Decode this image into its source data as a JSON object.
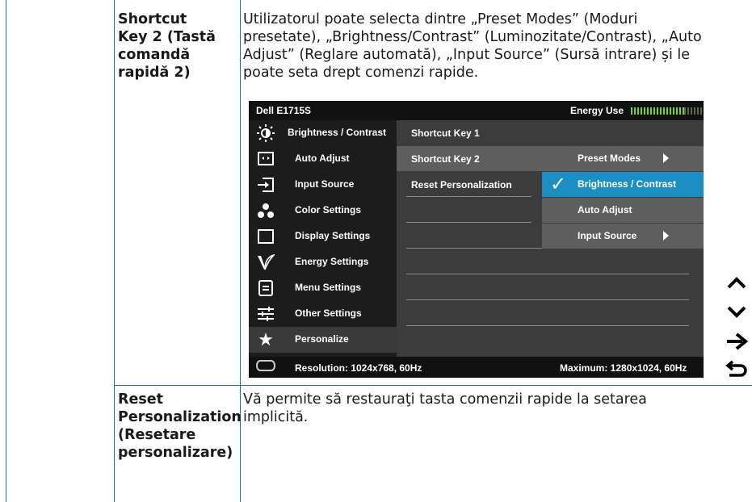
{
  "rows": [
    {
      "label": "Shortcut Key 2 (Tastă comandă rapidă 2)",
      "label_lines": [
        "Shortcut",
        "Key 2 (Tastă",
        "comandă",
        "rapidă 2)"
      ],
      "description_lines": [
        "Utilizatorul poate selecta dintre „Preset Modes” (Moduri",
        "presetate), „Brightness/Contrast” (Luminozitate/Contrast), „Auto",
        "Adjust” (Reglare automată), „Input Source” (Sursă intrare) și le",
        "poate seta drept comenzi rapide."
      ]
    },
    {
      "label": "Reset Personalization (Resetare personalizare)",
      "label_lines": [
        "Reset",
        "Personalization",
        "(Resetare",
        "personalizare)"
      ],
      "description_lines": [
        "Vă permite să restauraţi tasta comenzii rapide la setarea",
        "implicită."
      ]
    }
  ],
  "osd": {
    "model": "Dell E1715S",
    "energy_label": "Energy Use",
    "energy_level": 0.75,
    "menu": [
      {
        "label": "Brightness / Contrast",
        "icon": "brightness-icon",
        "selected": false
      },
      {
        "label": "Auto Adjust",
        "icon": "auto-adjust-icon",
        "selected": false
      },
      {
        "label": "Input Source",
        "icon": "input-source-icon",
        "selected": false
      },
      {
        "label": "Color Settings",
        "icon": "color-settings-icon",
        "selected": false
      },
      {
        "label": "Display Settings",
        "icon": "display-settings-icon",
        "selected": false
      },
      {
        "label": "Energy Settings",
        "icon": "energy-settings-icon",
        "selected": false
      },
      {
        "label": "Menu Settings",
        "icon": "menu-settings-icon",
        "selected": false
      },
      {
        "label": "Other Settings",
        "icon": "other-settings-icon",
        "selected": false
      },
      {
        "label": "Personalize",
        "icon": "star-icon",
        "selected": true
      }
    ],
    "panel_items": [
      "Shortcut Key 1",
      "Shortcut Key 2",
      "Reset Personalization"
    ],
    "submenu": [
      {
        "label": "Preset Modes",
        "checked": false,
        "has_arrow": true
      },
      {
        "label": "Brightness / Contrast",
        "checked": true,
        "has_arrow": false
      },
      {
        "label": "Auto Adjust",
        "checked": false,
        "has_arrow": false
      },
      {
        "label": "Input Source",
        "checked": false,
        "has_arrow": true
      }
    ],
    "resolution": "Resolution: 1024x768, 60Hz",
    "maximum": "Maximum: 1280x1024, 60Hz"
  },
  "nav_buttons": [
    "up-icon",
    "down-icon",
    "enter-icon",
    "back-icon"
  ],
  "colors": {
    "rule": "#1c6fa8",
    "highlight": "#1b8fc4",
    "energy_bar": "#7fd11a"
  }
}
